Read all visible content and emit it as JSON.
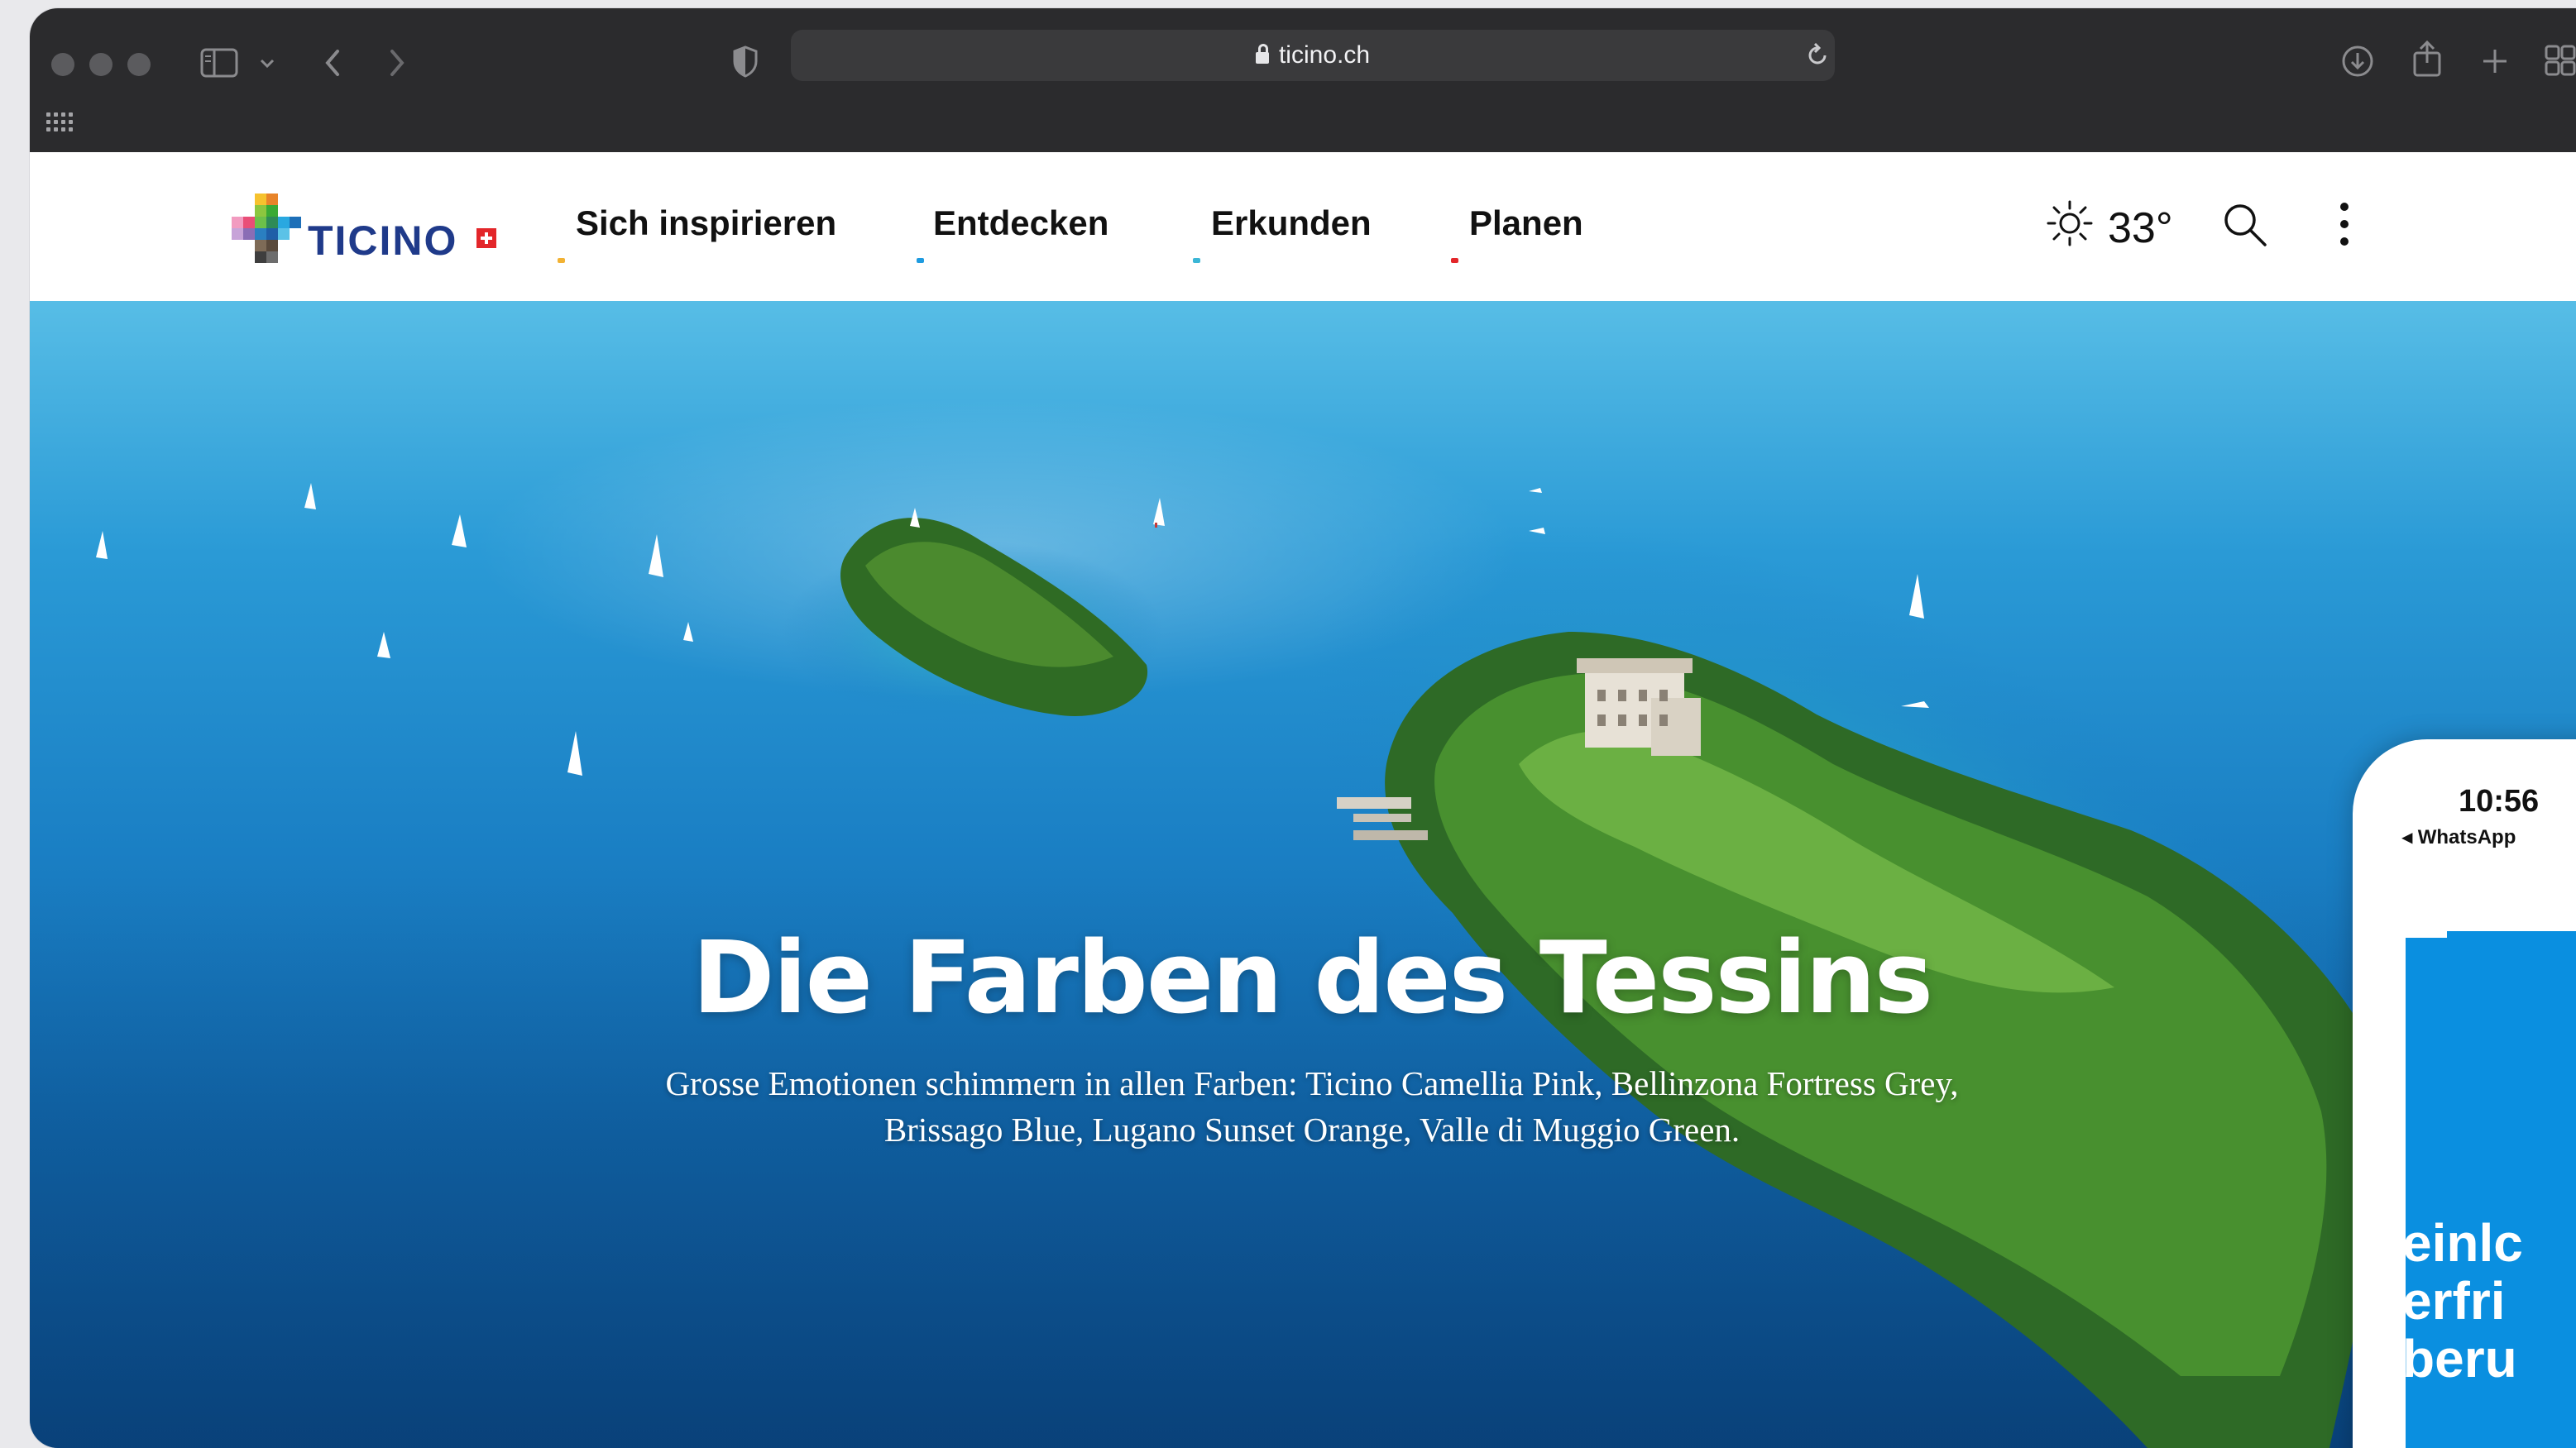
{
  "browser": {
    "url": "ticino.ch",
    "icons": [
      "sidebar-icon",
      "chevron-down-icon",
      "back-icon",
      "forward-icon",
      "shield-icon",
      "reload-icon",
      "download-icon",
      "share-icon",
      "new-tab-icon",
      "tab-overview-icon",
      "apps-grid-icon"
    ]
  },
  "site": {
    "logo_text": "TICINO",
    "nav": [
      "Sich inspirieren",
      "Entdecken",
      "Erkunden",
      "Planen"
    ],
    "nav_dot_colors": [
      "#f2b233",
      "#1e9be0",
      "#3bb6d6",
      "#e3262a"
    ],
    "weather": {
      "icon": "sun-icon",
      "temperature": "33°"
    },
    "header_icons": [
      "search-icon",
      "more-vertical-icon"
    ]
  },
  "hero": {
    "title": "Die Farben des Tessins",
    "subtitle": "Grosse Emotionen schimmern in allen Farben: Ticino Camellia Pink, Bellinzona Fortress Grey, Brissago Blue, Lugano Sunset Orange, Valle di Muggio Green."
  },
  "phone": {
    "time": "10:56",
    "back_label": "◂ WhatsApp",
    "text_lines": [
      "einlc",
      "erfri",
      "beru"
    ]
  },
  "colors": {
    "chrome": "#2b2b2d",
    "water": "#1a7fc4",
    "phone_accent": "#0a8fe0"
  }
}
